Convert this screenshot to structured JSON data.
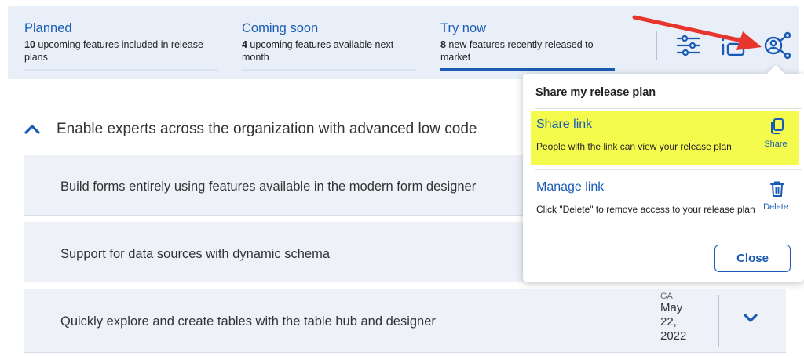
{
  "tabs": [
    {
      "title": "Planned",
      "count": "10",
      "desc_rest": " upcoming features included in release",
      "desc_line2": "plans"
    },
    {
      "title": "Coming soon",
      "count": "4",
      "desc_rest": " upcoming features available next",
      "desc_line2": "month"
    },
    {
      "title": "Try now",
      "count": "8",
      "desc_rest": " new features recently released to",
      "desc_line2": "market"
    }
  ],
  "toolbar": {
    "filter_icon": "sliders-icon",
    "list_icon": "list-icon",
    "share_icon": "share-people-icon"
  },
  "section": {
    "title": "Enable experts across the organization with advanced low code"
  },
  "rows": [
    {
      "text": "Build forms entirely using features available in the modern form designer"
    },
    {
      "text": "Support for data sources with dynamic schema"
    },
    {
      "text": "Quickly explore and create tables with the table hub and designer",
      "date_label": "GA",
      "date_line1": "May",
      "date_line2": "22,",
      "date_line3": "2022"
    }
  ],
  "popup": {
    "title": "Share my release plan",
    "share": {
      "title": "Share link",
      "desc": "People with the link can view your release plan",
      "action": "Share"
    },
    "manage": {
      "title": "Manage link",
      "desc": "Click \"Delete\" to remove access to your release plan",
      "action": "Delete"
    },
    "close_label": "Close"
  },
  "colors": {
    "accent": "#1b5bb5",
    "highlight": "#f5fb4d",
    "annotation": "#e8362f"
  }
}
